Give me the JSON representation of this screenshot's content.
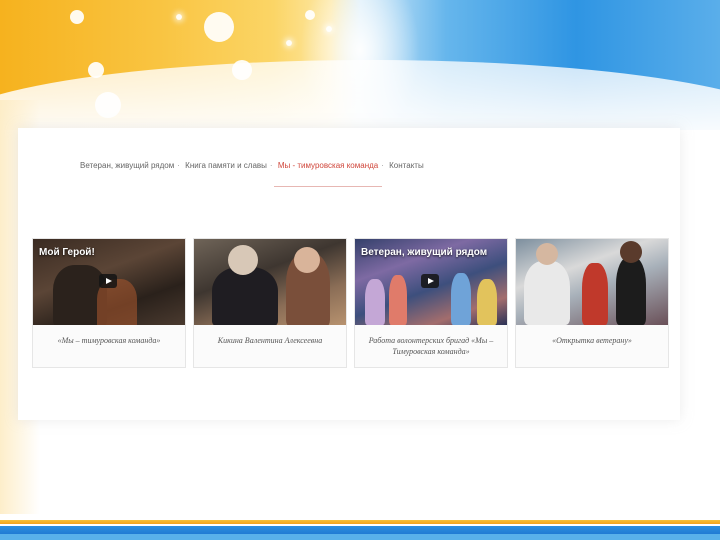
{
  "nav": {
    "items": [
      {
        "label": "Ветеран, живущий рядом",
        "active": false
      },
      {
        "label": "Книга памяти и славы",
        "active": false
      },
      {
        "label": "Мы - тимуровская команда",
        "active": true
      },
      {
        "label": "Контакты",
        "active": false
      }
    ]
  },
  "cards": [
    {
      "overlay_title": "Мой Герой!",
      "has_play": true,
      "caption": "«Мы – тимуровская команда»"
    },
    {
      "overlay_title": "",
      "has_play": false,
      "caption": "Кикина Валентина Алексеевна"
    },
    {
      "overlay_title": "Ветеран, живущий рядом",
      "has_play": true,
      "caption": "Работа волонтерских бригад «Мы – Тимуровская команда»"
    },
    {
      "overlay_title": "",
      "has_play": false,
      "caption": "«Открытка ветерану»"
    }
  ],
  "colors": {
    "nav_active": "#d0463b",
    "nav_text": "#666666",
    "header_orange": "#f6b21e",
    "header_blue": "#2f95e3"
  }
}
